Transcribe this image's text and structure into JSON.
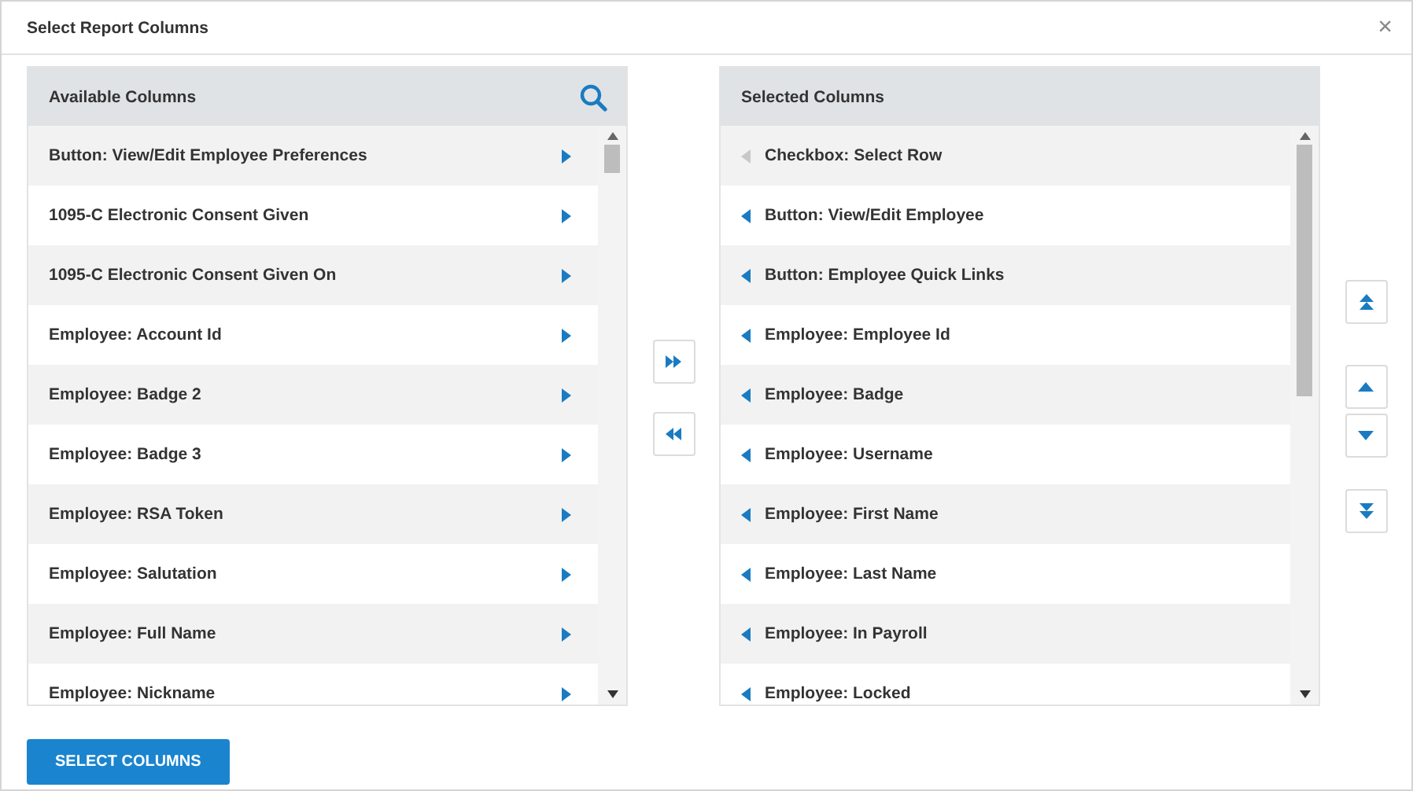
{
  "dialog": {
    "title": "Select Report Columns",
    "close": "×"
  },
  "available": {
    "title": "Available Columns",
    "items": [
      {
        "label": "Button: View/Edit Employee Preferences"
      },
      {
        "label": "1095-C Electronic Consent Given"
      },
      {
        "label": "1095-C Electronic Consent Given On"
      },
      {
        "label": "Employee: Account Id"
      },
      {
        "label": "Employee: Badge 2"
      },
      {
        "label": "Employee: Badge 3"
      },
      {
        "label": "Employee: RSA Token"
      },
      {
        "label": "Employee: Salutation"
      },
      {
        "label": "Employee: Full Name"
      },
      {
        "label": "Employee: Nickname"
      }
    ]
  },
  "selected": {
    "title": "Selected Columns",
    "items": [
      {
        "label": "Checkbox: Select Row",
        "disabled": true
      },
      {
        "label": "Button: View/Edit Employee",
        "disabled": false
      },
      {
        "label": "Button: Employee Quick Links",
        "disabled": false
      },
      {
        "label": "Employee: Employee Id",
        "disabled": false
      },
      {
        "label": "Employee: Badge",
        "disabled": false
      },
      {
        "label": "Employee: Username",
        "disabled": false
      },
      {
        "label": "Employee: First Name",
        "disabled": false
      },
      {
        "label": "Employee: Last Name",
        "disabled": false
      },
      {
        "label": "Employee: In Payroll",
        "disabled": false
      },
      {
        "label": "Employee: Locked",
        "disabled": false
      }
    ]
  },
  "submit": "SELECT COLUMNS"
}
